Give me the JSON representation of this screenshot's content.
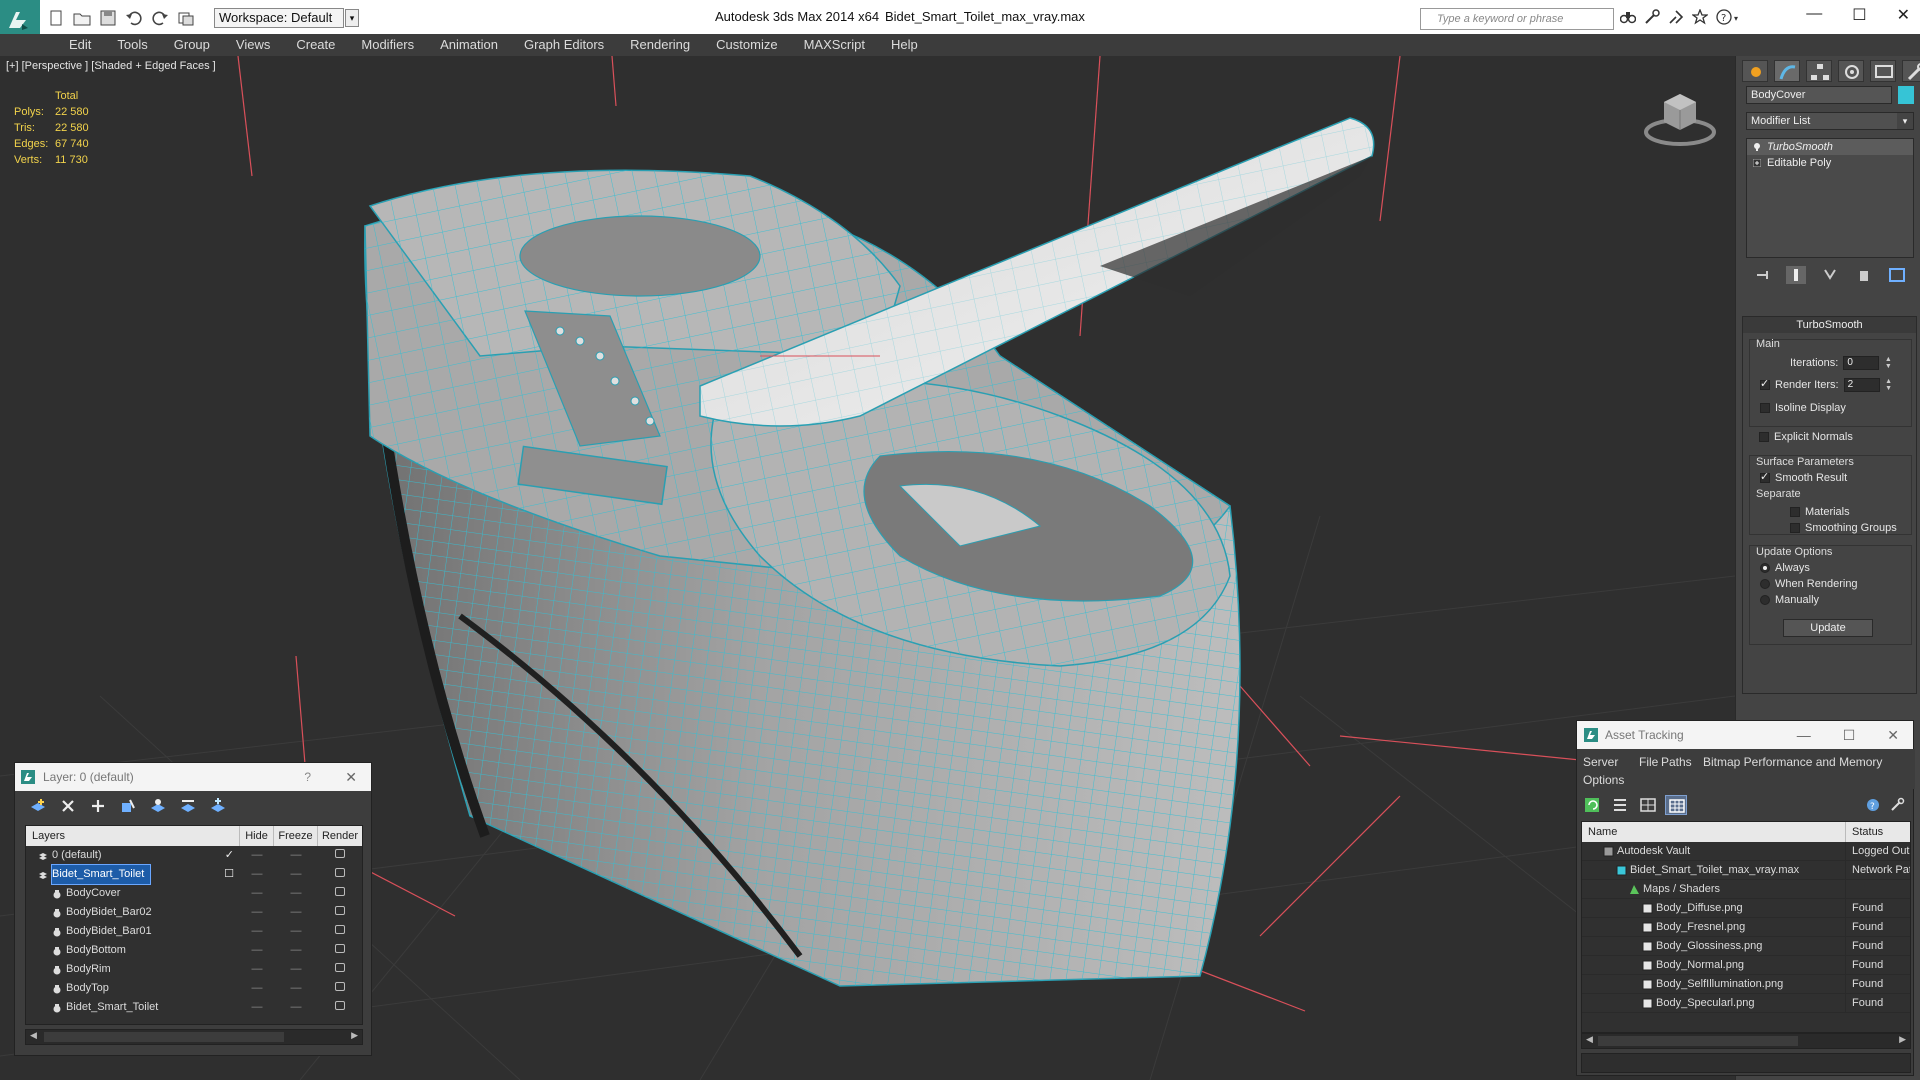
{
  "titlebar": {
    "app_title": "Autodesk 3ds Max  2014 x64",
    "file_title": "Bidet_Smart_Toilet_max_vray.max",
    "workspace_label": "Workspace: Default",
    "search_placeholder": "Type a keyword or phrase",
    "window_controls": [
      "—",
      "☐",
      "✕"
    ]
  },
  "menu": {
    "items": [
      "Edit",
      "Tools",
      "Group",
      "Views",
      "Create",
      "Modifiers",
      "Animation",
      "Graph Editors",
      "Rendering",
      "Customize",
      "MAXScript",
      "Help"
    ]
  },
  "viewport": {
    "label": "[+] [Perspective ] [Shaded + Edged Faces ]",
    "stats": {
      "header": "Total",
      "rows": [
        {
          "key": "Polys:",
          "value": "22 580"
        },
        {
          "key": "Tris:",
          "value": "22 580"
        },
        {
          "key": "Edges:",
          "value": "67 740"
        },
        {
          "key": "Verts:",
          "value": "11 730"
        }
      ]
    },
    "colors": {
      "wire": "#34bfd3",
      "surface": "#9a9a9a",
      "grid": "#3a3a3a",
      "axis": "#d9505a"
    }
  },
  "command_panel": {
    "object_name": "BodyCover",
    "object_color": "#36c4d6",
    "modifier_list_label": "Modifier List",
    "stack": [
      {
        "label": "TurboSmooth",
        "selected": true
      },
      {
        "label": "Editable Poly",
        "selected": false
      }
    ],
    "rollout_title": "TurboSmooth",
    "main": {
      "label": "Main",
      "iterations_label": "Iterations:",
      "iterations_value": "0",
      "render_iters_label": "Render Iters:",
      "render_iters_value": "2",
      "render_iters_checked": true,
      "isoline_label": "Isoline Display",
      "explicit_label": "Explicit Normals"
    },
    "surface": {
      "label": "Surface Parameters",
      "smooth_result_label": "Smooth Result",
      "separate_label": "Separate",
      "materials_label": "Materials",
      "smoothing_groups_label": "Smoothing Groups"
    },
    "update": {
      "label": "Update Options",
      "options": [
        "Always",
        "When Rendering",
        "Manually"
      ],
      "selected": "Always",
      "button": "Update"
    }
  },
  "layer_dialog": {
    "title": "Layer: 0 (default)",
    "help": "?",
    "close": "✕",
    "columns": [
      "Layers",
      "Hide",
      "Freeze",
      "Render"
    ],
    "rows": [
      {
        "label": "0 (default)",
        "indent": 0,
        "kind": "layer",
        "selected": false,
        "current": true
      },
      {
        "label": "Bidet_Smart_Toilet",
        "indent": 0,
        "kind": "layer",
        "selected": true,
        "current": false
      },
      {
        "label": "BodyCover",
        "indent": 1,
        "kind": "object"
      },
      {
        "label": "BodyBidet_Bar02",
        "indent": 1,
        "kind": "object"
      },
      {
        "label": "BodyBidet_Bar01",
        "indent": 1,
        "kind": "object"
      },
      {
        "label": "BodyBottom",
        "indent": 1,
        "kind": "object"
      },
      {
        "label": "BodyRim",
        "indent": 1,
        "kind": "object"
      },
      {
        "label": "BodyTop",
        "indent": 1,
        "kind": "object"
      },
      {
        "label": "Bidet_Smart_Toilet",
        "indent": 1,
        "kind": "object"
      }
    ],
    "dash": "—"
  },
  "asset_dialog": {
    "title": "Asset Tracking",
    "menu": [
      "Server",
      "File",
      "Paths",
      "Bitmap Performance and Memory",
      "Options"
    ],
    "columns": [
      "Name",
      "Status"
    ],
    "rows": [
      {
        "name": "Autodesk Vault",
        "status": "Logged Out",
        "indent": 1,
        "icon": "vault"
      },
      {
        "name": "Bidet_Smart_Toilet_max_vray.max",
        "status": "Network Path",
        "indent": 2,
        "icon": "max"
      },
      {
        "name": "Maps / Shaders",
        "status": "",
        "indent": 3,
        "icon": "maps"
      },
      {
        "name": "Body_Diffuse.png",
        "status": "Found",
        "indent": 4,
        "icon": "image"
      },
      {
        "name": "Body_Fresnel.png",
        "status": "Found",
        "indent": 4,
        "icon": "image"
      },
      {
        "name": "Body_Glossiness.png",
        "status": "Found",
        "indent": 4,
        "icon": "image"
      },
      {
        "name": "Body_Normal.png",
        "status": "Found",
        "indent": 4,
        "icon": "image"
      },
      {
        "name": "Body_SelfIllumination.png",
        "status": "Found",
        "indent": 4,
        "icon": "image"
      },
      {
        "name": "Body_Specularl.png",
        "status": "Found",
        "indent": 4,
        "icon": "image"
      }
    ]
  }
}
